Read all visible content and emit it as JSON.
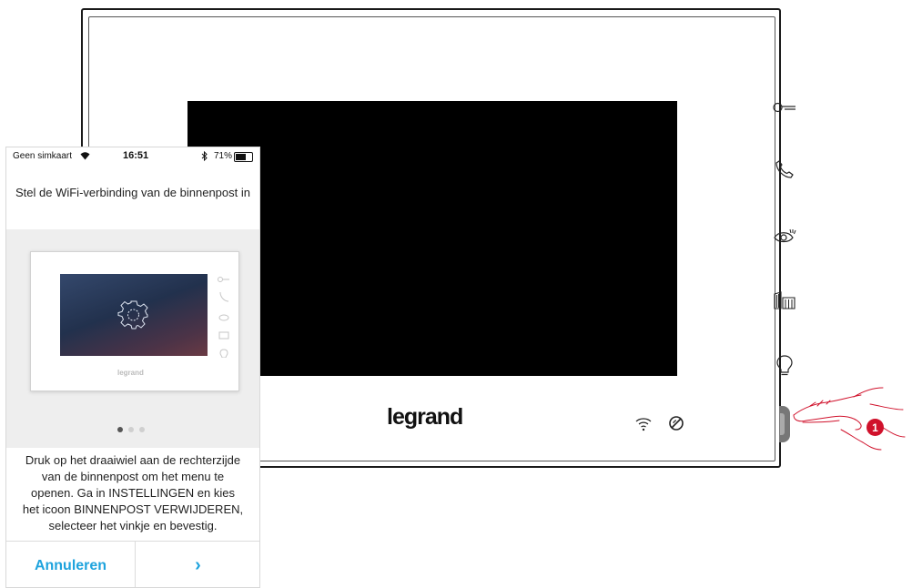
{
  "device": {
    "brand": "legrand",
    "side_buttons": [
      "key-icon",
      "phone-handset-icon",
      "eye-icon",
      "gate-icon",
      "lightbulb-icon"
    ],
    "status_icons": [
      "wifi-icon",
      "do-not-disturb-icon"
    ]
  },
  "callout": {
    "number": "1",
    "color": "#d0112b"
  },
  "phone": {
    "statusbar": {
      "carrier": "Geen simkaart",
      "time": "16:51",
      "battery": "71%",
      "battery_level": 0.71
    },
    "header_title": "Stel de WiFi-verbinding van de binnenpost in",
    "carousel": {
      "page_count": 3,
      "active_index": 0
    },
    "instructions": [
      "Druk op het draaiwiel aan de rechterzijde",
      "van de binnenpost om het menu te",
      "openen. Ga in INSTELLINGEN en kies",
      "het icoon BINNENPOST VERWIJDEREN,",
      "selecteer het vinkje en bevestig."
    ],
    "cancel_label": "Annuleren",
    "next_label": "›",
    "accent_color": "#1ea3dd"
  }
}
